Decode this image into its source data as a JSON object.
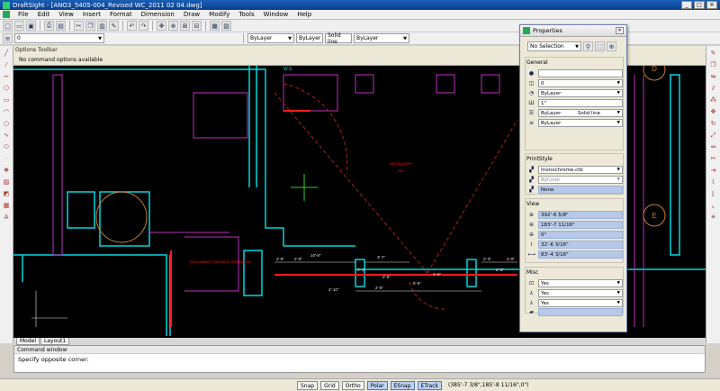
{
  "window": {
    "app_name": "DraftSight",
    "title": "DraftSight - [ANO3_5405-004_Revised WC_2011 02 04.dwg]"
  },
  "menu": [
    "File",
    "Edit",
    "View",
    "Insert",
    "Format",
    "Dimension",
    "Draw",
    "Modify",
    "Tools",
    "Window",
    "Help"
  ],
  "toolbar2": {
    "layer_value": "0",
    "color_value": "ByLayer",
    "linestyle_value": "ByLayer",
    "lineweight_value": "Solid line",
    "linetype_value": "ByLayer"
  },
  "options_toolbar": {
    "title": "Options Toolbar",
    "message": "No command options available"
  },
  "canvas": {
    "label_room": "W.S.",
    "label_red1": "INSTALLIGHT",
    "label_red2": "7/8",
    "label_red3": "DISCONNECT SERVICE ENTRANCE",
    "dims": [
      "2'-9\"",
      "10'-8\"",
      "3'-7\"",
      "2'-9\"",
      "2'-3\"",
      "2'-9\"",
      "2'-10\"",
      "2'-6\"",
      "6'-6\"",
      "4'-6\"",
      "2'-1\"",
      "2'-6\"",
      "2'-9\""
    ],
    "grid_marker_d": "D",
    "grid_marker_e": "E"
  },
  "tabs": [
    "Model",
    "Layout1"
  ],
  "command_window": {
    "title": "Command window",
    "text": "Specify opposite corner:"
  },
  "statusbar": {
    "buttons": [
      {
        "label": "Snap",
        "on": false
      },
      {
        "label": "Grid",
        "on": false
      },
      {
        "label": "Ortho",
        "on": false
      },
      {
        "label": "Polar",
        "on": true
      },
      {
        "label": "ESnap",
        "on": true
      },
      {
        "label": "ETrack",
        "on": true
      }
    ],
    "coords": "(385'-7 3/8\",185'-8 11/16\",0\")"
  },
  "properties": {
    "title": "Properties",
    "selection": "No Selection",
    "general_header": "General",
    "general": {
      "color": "",
      "layer": "0",
      "linecolor": "ByLayer",
      "scale": "1\"",
      "linestyle_a": "ByLayer",
      "linestyle_b": "Solid line",
      "lineweight": "ByLayer"
    },
    "printstyle_header": "PrintStyle",
    "printstyle": {
      "table": "monochrome.ctb",
      "style": "ByColor",
      "attached": "None"
    },
    "view_header": "View",
    "view": [
      "392'-6 5/8\"",
      "183'-7 11/16\"",
      "0\"",
      "32'-6 3/16\"",
      "83'-4 3/16\""
    ],
    "misc_header": "Misc",
    "misc": [
      "Yes",
      "Yes",
      "Yes",
      ""
    ]
  },
  "colors": {
    "canvas_bg": "#000000",
    "cyan": "#00d8e0",
    "magenta": "#c030c0",
    "red": "#ff1a1a",
    "white": "#e8e8e8",
    "green": "#30d030"
  }
}
